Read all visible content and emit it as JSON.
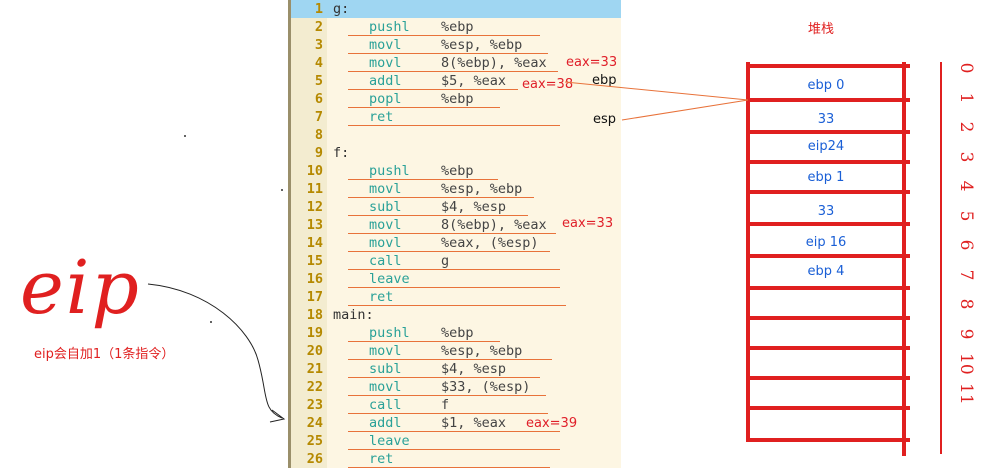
{
  "code_lines": [
    {
      "n": "1",
      "label": "g:",
      "mn": "",
      "ops": "",
      "hl": true
    },
    {
      "n": "2",
      "label": "",
      "mn": "pushl",
      "ops": "%ebp"
    },
    {
      "n": "3",
      "label": "",
      "mn": "movl",
      "ops": "%esp, %ebp"
    },
    {
      "n": "4",
      "label": "",
      "mn": "movl",
      "ops": "8(%ebp), %eax"
    },
    {
      "n": "5",
      "label": "",
      "mn": "addl",
      "ops": "$5, %eax"
    },
    {
      "n": "6",
      "label": "",
      "mn": "popl",
      "ops": "%ebp"
    },
    {
      "n": "7",
      "label": "",
      "mn": "ret",
      "ops": ""
    },
    {
      "n": "8",
      "label": "",
      "mn": "",
      "ops": ""
    },
    {
      "n": "9",
      "label": "f:",
      "mn": "",
      "ops": ""
    },
    {
      "n": "10",
      "label": "",
      "mn": "pushl",
      "ops": "%ebp"
    },
    {
      "n": "11",
      "label": "",
      "mn": "movl",
      "ops": "%esp, %ebp"
    },
    {
      "n": "12",
      "label": "",
      "mn": "subl",
      "ops": "$4, %esp"
    },
    {
      "n": "13",
      "label": "",
      "mn": "movl",
      "ops": "8(%ebp), %eax"
    },
    {
      "n": "14",
      "label": "",
      "mn": "movl",
      "ops": "%eax, (%esp)"
    },
    {
      "n": "15",
      "label": "",
      "mn": "call",
      "ops": "g"
    },
    {
      "n": "16",
      "label": "",
      "mn": "leave",
      "ops": ""
    },
    {
      "n": "17",
      "label": "",
      "mn": "ret",
      "ops": ""
    },
    {
      "n": "18",
      "label": "main:",
      "mn": "",
      "ops": ""
    },
    {
      "n": "19",
      "label": "",
      "mn": "pushl",
      "ops": "%ebp"
    },
    {
      "n": "20",
      "label": "",
      "mn": "movl",
      "ops": "%esp, %ebp"
    },
    {
      "n": "21",
      "label": "",
      "mn": "subl",
      "ops": "$4, %esp"
    },
    {
      "n": "22",
      "label": "",
      "mn": "movl",
      "ops": "$33, (%esp)"
    },
    {
      "n": "23",
      "label": "",
      "mn": "call",
      "ops": "f"
    },
    {
      "n": "24",
      "label": "",
      "mn": "addl",
      "ops": "$1, %eax"
    },
    {
      "n": "25",
      "label": "",
      "mn": "leave",
      "ops": ""
    },
    {
      "n": "26",
      "label": "",
      "mn": "ret",
      "ops": ""
    }
  ],
  "annotations": {
    "eax_line4": "eax=33",
    "eax_line5": "eax=38",
    "eax_line13": "eax=33",
    "eax_line24": "eax=39",
    "ebp_label": "ebp",
    "esp_label": "esp"
  },
  "eip": {
    "big": "eip",
    "note": "eip会自加1（1条指令）"
  },
  "stack": {
    "title": "堆栈",
    "cells": [
      "ebp 0",
      "33",
      "eip24",
      "ebp 1",
      "33",
      "eip 16",
      "ebp 4"
    ],
    "indices": [
      "0",
      "1",
      "2",
      "3",
      "4",
      "5",
      "6",
      "7",
      "8",
      "9",
      "10",
      "11"
    ]
  },
  "colors": {
    "annotation_red": "#e02020",
    "underline_orange": "#e8723a",
    "cell_text_blue": "#1a5fd6",
    "line_number_gold": "#b58900",
    "mnemonic_teal": "#2aa198",
    "highlight_blue": "#9fd6f2"
  }
}
